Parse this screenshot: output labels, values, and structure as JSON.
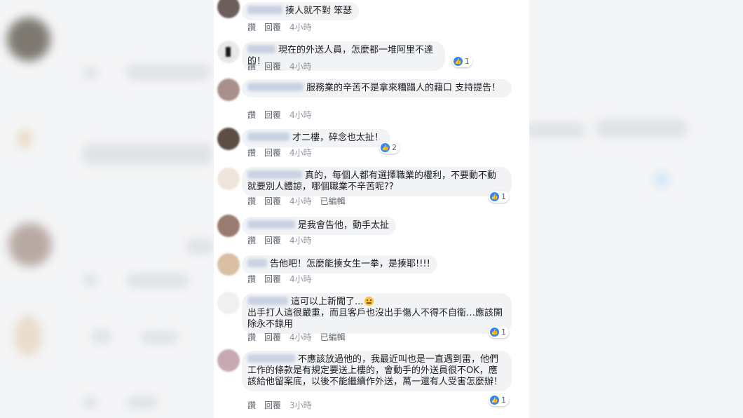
{
  "actions": {
    "like": "讚",
    "reply": "回覆",
    "edited": "已編輯"
  },
  "comments": [
    {
      "text": "揍人就不對 笨瑟",
      "time": "4小時",
      "reactions": ""
    },
    {
      "text": "現在的外送人員，怎麼都一堆阿里不達的！",
      "time": "4小時",
      "reactions": "1"
    },
    {
      "text": "服務業的辛苦不是拿來糟蹋人的藉口 支持提告！",
      "time": "4小時",
      "reactions": ""
    },
    {
      "text": "才二樓，碎念也太扯！",
      "time": "4小時",
      "reactions": "2"
    },
    {
      "text": "真的，每個人都有選擇職業的權利，不要動不動就要別人體諒，哪個職業不辛苦呢??",
      "time": "4小時",
      "reactions": "1"
    },
    {
      "text": "是我會告他，動手太扯",
      "time": "4小時",
      "reactions": ""
    },
    {
      "text": "告他吧！怎麼能揍女生一拳，是揍耶!!!!",
      "time": "4小時",
      "reactions": ""
    },
    {
      "text_line1": "這可以上新聞了...",
      "text_rest": "出手打人這很嚴重，而且客戶也沒出手傷人不得不自衛…應該開除永不錄用",
      "time": "4小時",
      "reactions": "1"
    },
    {
      "text": "不應該放過他的，我最近叫也是一直遇到雷，他們工作的條款是有規定要送上樓的，會動手的外送員很不OK，應該給他留案底，以後不能繼續作外送，萬一還有人受害怎麼辦！",
      "time": "3小時",
      "reactions": "1"
    }
  ]
}
